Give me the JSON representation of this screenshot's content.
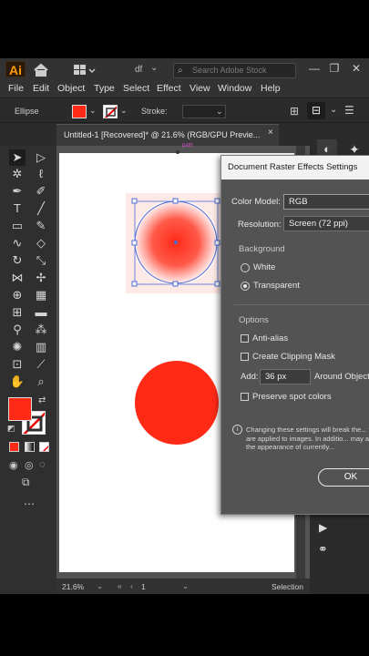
{
  "app": {
    "logo": "Ai",
    "workspace_name": "df",
    "search_placeholder": "Search Adobe Stock"
  },
  "window_controls": {
    "minimize": "—",
    "restore": "❐",
    "close": "✕"
  },
  "menu": [
    "File",
    "Edit",
    "Object",
    "Type",
    "Select",
    "Effect",
    "View",
    "Window",
    "Help"
  ],
  "control_bar": {
    "selection_label": "Ellipse",
    "stroke_label": "Stroke:",
    "fill_color": "#ff2a16"
  },
  "document_tab": {
    "title": "Untitled-1 [Recovered]* @ 21.6% (RGB/GPU Previe...",
    "close": "×"
  },
  "canvas": {
    "path_hint": "path",
    "gradient_circle_color": "#ff2a16",
    "solid_circle_color": "#ff2a16"
  },
  "status_bar": {
    "zoom": "21.6%",
    "artboard_number": "1",
    "tool": "Selection"
  },
  "dialog": {
    "title": "Document Raster Effects Settings",
    "color_model_label": "Color Model:",
    "color_model_value": "RGB",
    "resolution_label": "Resolution:",
    "resolution_value": "Screen (72 ppi)",
    "background_header": "Background",
    "bg_white": "White",
    "bg_transparent": "Transparent",
    "options_header": "Options",
    "anti_alias": "Anti-alias",
    "clipping_mask": "Create Clipping Mask",
    "add_label": "Add:",
    "add_value": "36 px",
    "around_object": "Around Object",
    "preserve_spot": "Preserve spot colors",
    "info": "Changing these settings will break the... that are applied to images. In additio... may affect the appearance of currently...",
    "ok": "OK"
  }
}
